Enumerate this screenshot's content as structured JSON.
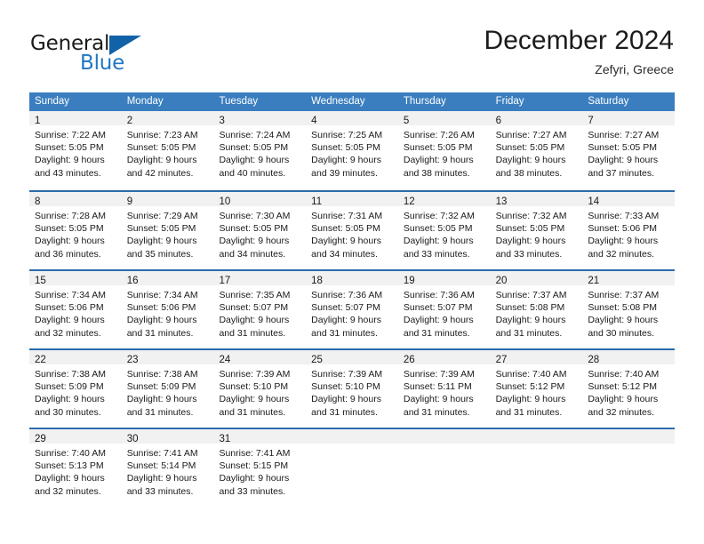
{
  "logo": {
    "word1": "General",
    "word2": "Blue",
    "triangle_color": "#1262a8",
    "blue_color": "#1f77c2"
  },
  "header": {
    "title": "December 2024",
    "subtitle": "Zefyri, Greece"
  },
  "theme": {
    "header_bar_color": "#3a7ebf",
    "row_divider_color": "#2b6cab",
    "day_band_color": "#f1f1f1"
  },
  "calendar": {
    "weekdays": [
      "Sunday",
      "Monday",
      "Tuesday",
      "Wednesday",
      "Thursday",
      "Friday",
      "Saturday"
    ],
    "weeks": [
      [
        {
          "day": "1",
          "sunrise": "Sunrise: 7:22 AM",
          "sunset": "Sunset: 5:05 PM",
          "daylight1": "Daylight: 9 hours",
          "daylight2": "and 43 minutes."
        },
        {
          "day": "2",
          "sunrise": "Sunrise: 7:23 AM",
          "sunset": "Sunset: 5:05 PM",
          "daylight1": "Daylight: 9 hours",
          "daylight2": "and 42 minutes."
        },
        {
          "day": "3",
          "sunrise": "Sunrise: 7:24 AM",
          "sunset": "Sunset: 5:05 PM",
          "daylight1": "Daylight: 9 hours",
          "daylight2": "and 40 minutes."
        },
        {
          "day": "4",
          "sunrise": "Sunrise: 7:25 AM",
          "sunset": "Sunset: 5:05 PM",
          "daylight1": "Daylight: 9 hours",
          "daylight2": "and 39 minutes."
        },
        {
          "day": "5",
          "sunrise": "Sunrise: 7:26 AM",
          "sunset": "Sunset: 5:05 PM",
          "daylight1": "Daylight: 9 hours",
          "daylight2": "and 38 minutes."
        },
        {
          "day": "6",
          "sunrise": "Sunrise: 7:27 AM",
          "sunset": "Sunset: 5:05 PM",
          "daylight1": "Daylight: 9 hours",
          "daylight2": "and 38 minutes."
        },
        {
          "day": "7",
          "sunrise": "Sunrise: 7:27 AM",
          "sunset": "Sunset: 5:05 PM",
          "daylight1": "Daylight: 9 hours",
          "daylight2": "and 37 minutes."
        }
      ],
      [
        {
          "day": "8",
          "sunrise": "Sunrise: 7:28 AM",
          "sunset": "Sunset: 5:05 PM",
          "daylight1": "Daylight: 9 hours",
          "daylight2": "and 36 minutes."
        },
        {
          "day": "9",
          "sunrise": "Sunrise: 7:29 AM",
          "sunset": "Sunset: 5:05 PM",
          "daylight1": "Daylight: 9 hours",
          "daylight2": "and 35 minutes."
        },
        {
          "day": "10",
          "sunrise": "Sunrise: 7:30 AM",
          "sunset": "Sunset: 5:05 PM",
          "daylight1": "Daylight: 9 hours",
          "daylight2": "and 34 minutes."
        },
        {
          "day": "11",
          "sunrise": "Sunrise: 7:31 AM",
          "sunset": "Sunset: 5:05 PM",
          "daylight1": "Daylight: 9 hours",
          "daylight2": "and 34 minutes."
        },
        {
          "day": "12",
          "sunrise": "Sunrise: 7:32 AM",
          "sunset": "Sunset: 5:05 PM",
          "daylight1": "Daylight: 9 hours",
          "daylight2": "and 33 minutes."
        },
        {
          "day": "13",
          "sunrise": "Sunrise: 7:32 AM",
          "sunset": "Sunset: 5:05 PM",
          "daylight1": "Daylight: 9 hours",
          "daylight2": "and 33 minutes."
        },
        {
          "day": "14",
          "sunrise": "Sunrise: 7:33 AM",
          "sunset": "Sunset: 5:06 PM",
          "daylight1": "Daylight: 9 hours",
          "daylight2": "and 32 minutes."
        }
      ],
      [
        {
          "day": "15",
          "sunrise": "Sunrise: 7:34 AM",
          "sunset": "Sunset: 5:06 PM",
          "daylight1": "Daylight: 9 hours",
          "daylight2": "and 32 minutes."
        },
        {
          "day": "16",
          "sunrise": "Sunrise: 7:34 AM",
          "sunset": "Sunset: 5:06 PM",
          "daylight1": "Daylight: 9 hours",
          "daylight2": "and 31 minutes."
        },
        {
          "day": "17",
          "sunrise": "Sunrise: 7:35 AM",
          "sunset": "Sunset: 5:07 PM",
          "daylight1": "Daylight: 9 hours",
          "daylight2": "and 31 minutes."
        },
        {
          "day": "18",
          "sunrise": "Sunrise: 7:36 AM",
          "sunset": "Sunset: 5:07 PM",
          "daylight1": "Daylight: 9 hours",
          "daylight2": "and 31 minutes."
        },
        {
          "day": "19",
          "sunrise": "Sunrise: 7:36 AM",
          "sunset": "Sunset: 5:07 PM",
          "daylight1": "Daylight: 9 hours",
          "daylight2": "and 31 minutes."
        },
        {
          "day": "20",
          "sunrise": "Sunrise: 7:37 AM",
          "sunset": "Sunset: 5:08 PM",
          "daylight1": "Daylight: 9 hours",
          "daylight2": "and 31 minutes."
        },
        {
          "day": "21",
          "sunrise": "Sunrise: 7:37 AM",
          "sunset": "Sunset: 5:08 PM",
          "daylight1": "Daylight: 9 hours",
          "daylight2": "and 30 minutes."
        }
      ],
      [
        {
          "day": "22",
          "sunrise": "Sunrise: 7:38 AM",
          "sunset": "Sunset: 5:09 PM",
          "daylight1": "Daylight: 9 hours",
          "daylight2": "and 30 minutes."
        },
        {
          "day": "23",
          "sunrise": "Sunrise: 7:38 AM",
          "sunset": "Sunset: 5:09 PM",
          "daylight1": "Daylight: 9 hours",
          "daylight2": "and 31 minutes."
        },
        {
          "day": "24",
          "sunrise": "Sunrise: 7:39 AM",
          "sunset": "Sunset: 5:10 PM",
          "daylight1": "Daylight: 9 hours",
          "daylight2": "and 31 minutes."
        },
        {
          "day": "25",
          "sunrise": "Sunrise: 7:39 AM",
          "sunset": "Sunset: 5:10 PM",
          "daylight1": "Daylight: 9 hours",
          "daylight2": "and 31 minutes."
        },
        {
          "day": "26",
          "sunrise": "Sunrise: 7:39 AM",
          "sunset": "Sunset: 5:11 PM",
          "daylight1": "Daylight: 9 hours",
          "daylight2": "and 31 minutes."
        },
        {
          "day": "27",
          "sunrise": "Sunrise: 7:40 AM",
          "sunset": "Sunset: 5:12 PM",
          "daylight1": "Daylight: 9 hours",
          "daylight2": "and 31 minutes."
        },
        {
          "day": "28",
          "sunrise": "Sunrise: 7:40 AM",
          "sunset": "Sunset: 5:12 PM",
          "daylight1": "Daylight: 9 hours",
          "daylight2": "and 32 minutes."
        }
      ],
      [
        {
          "day": "29",
          "sunrise": "Sunrise: 7:40 AM",
          "sunset": "Sunset: 5:13 PM",
          "daylight1": "Daylight: 9 hours",
          "daylight2": "and 32 minutes."
        },
        {
          "day": "30",
          "sunrise": "Sunrise: 7:41 AM",
          "sunset": "Sunset: 5:14 PM",
          "daylight1": "Daylight: 9 hours",
          "daylight2": "and 33 minutes."
        },
        {
          "day": "31",
          "sunrise": "Sunrise: 7:41 AM",
          "sunset": "Sunset: 5:15 PM",
          "daylight1": "Daylight: 9 hours",
          "daylight2": "and 33 minutes."
        },
        {
          "day": "",
          "sunrise": "",
          "sunset": "",
          "daylight1": "",
          "daylight2": ""
        },
        {
          "day": "",
          "sunrise": "",
          "sunset": "",
          "daylight1": "",
          "daylight2": ""
        },
        {
          "day": "",
          "sunrise": "",
          "sunset": "",
          "daylight1": "",
          "daylight2": ""
        },
        {
          "day": "",
          "sunrise": "",
          "sunset": "",
          "daylight1": "",
          "daylight2": ""
        }
      ]
    ]
  }
}
